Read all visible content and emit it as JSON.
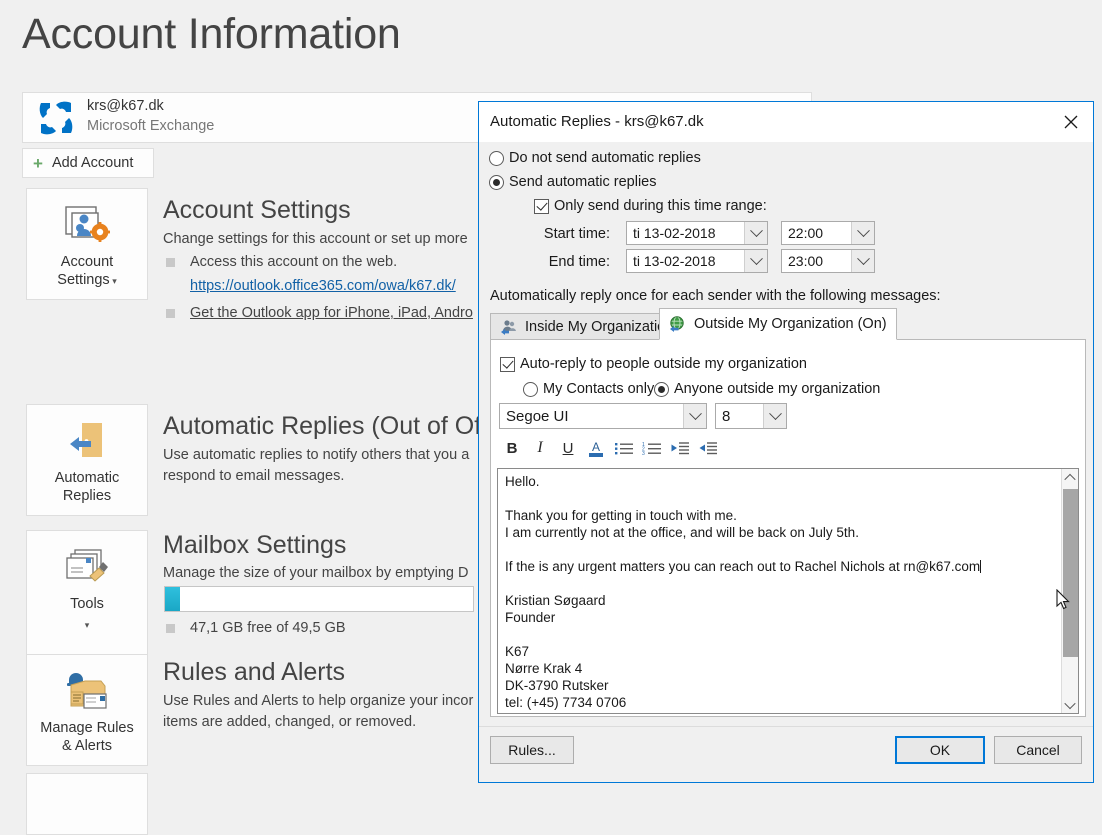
{
  "backstage": {
    "page_title": "Account Information",
    "account": {
      "email": "krs@k67.dk",
      "type": "Microsoft Exchange",
      "logo_icon": "exchange-logo-icon"
    },
    "add_account_label": "Add Account",
    "sections": [
      {
        "tile_label_line1": "Account",
        "tile_label_line2": "Settings",
        "tile_has_caret": true,
        "tile_icon": "account-settings-icon",
        "title": "Account Settings",
        "desc": "Change settings for this account or set up more",
        "bullets": [
          "Access this account on the web.",
          "https://outlook.office365.com/owa/k67.dk/",
          "Get the Outlook app for iPhone, iPad, Andro"
        ]
      },
      {
        "tile_label_line1": "Automatic",
        "tile_label_line2": "Replies",
        "tile_has_caret": false,
        "tile_icon": "out-of-office-door-icon",
        "title": "Automatic Replies (Out of Office",
        "desc_line1": "Use automatic replies to notify others that you a",
        "desc_line2": "respond to email messages."
      },
      {
        "tile_label_line1": "Tools",
        "tile_label_line2": "",
        "tile_has_caret": true,
        "tile_icon": "mailbox-cleanup-tools-icon",
        "title": "Mailbox Settings",
        "desc": "Manage the size of your mailbox by emptying D",
        "storage_text": "47,1 GB free of 49,5 GB",
        "storage_used_percent": 5
      },
      {
        "tile_label_line1": "Manage Rules",
        "tile_label_line2": "& Alerts",
        "tile_has_caret": false,
        "tile_icon": "rules-alerts-icon",
        "title": "Rules and Alerts",
        "desc_line1": "Use Rules and Alerts to help organize your incor",
        "desc_line2": "items are added, changed, or removed."
      }
    ]
  },
  "dialog": {
    "title": "Automatic Replies - krs@k67.dk",
    "close_icon": "close-icon",
    "radio_do_not_send": "Do not send automatic replies",
    "radio_send": "Send automatic replies",
    "send_selected": true,
    "time_range_checkbox": "Only send during this time range:",
    "time_range_checked": true,
    "start_time_label": "Start time:",
    "start_date_value": "ti 13-02-2018",
    "start_clock_value": "22:00",
    "end_time_label": "End time:",
    "end_date_value": "ti 13-02-2018",
    "end_clock_value": "23:00",
    "reply_note": "Automatically reply once for each sender with the following messages:",
    "tabs": [
      {
        "label": "Inside My Organization",
        "icon": "people-reply-icon",
        "active": false
      },
      {
        "label": "Outside My Organization (On)",
        "icon": "globe-reply-icon",
        "active": true
      }
    ],
    "auto_reply_checkbox": "Auto-reply to people outside my organization",
    "auto_reply_checked": true,
    "scope_contacts": "My Contacts only",
    "scope_anyone": "Anyone outside my organization",
    "scope_selected": "anyone",
    "font_family_value": "Segoe UI",
    "font_size_value": "8",
    "toolbar": [
      {
        "name": "bold-icon",
        "glyph": "B"
      },
      {
        "name": "italic-icon",
        "glyph": "I"
      },
      {
        "name": "underline-icon",
        "glyph": "U"
      },
      {
        "name": "font-color-icon",
        "glyph": "A"
      },
      {
        "name": "bulleted-list-icon",
        "glyph": ""
      },
      {
        "name": "numbered-list-icon",
        "glyph": ""
      },
      {
        "name": "decrease-indent-icon",
        "glyph": ""
      },
      {
        "name": "increase-indent-icon",
        "glyph": ""
      }
    ],
    "message_body": "Hello.\n\nThank you for getting in touch with me.\nI am currently not at the office, and will be back on July 5th.\n\nIf the is any urgent matters you can reach out to Rachel Nichols at rn@k67.com",
    "message_body_rest": "\n\nKristian Søgaard\nFounder\n\nK67\nNørre Krak 4\nDK-3790 Rutsker\ntel: (+45) 7734 0706",
    "buttons": {
      "rules": "Rules...",
      "ok": "OK",
      "cancel": "Cancel"
    }
  },
  "colors": {
    "accent_blue": "#0078d7",
    "link_blue": "#1261a6",
    "exchange_blue": "#0072c6",
    "progress_cyan": "#1aa7c6",
    "tile_border": "#dedede"
  }
}
